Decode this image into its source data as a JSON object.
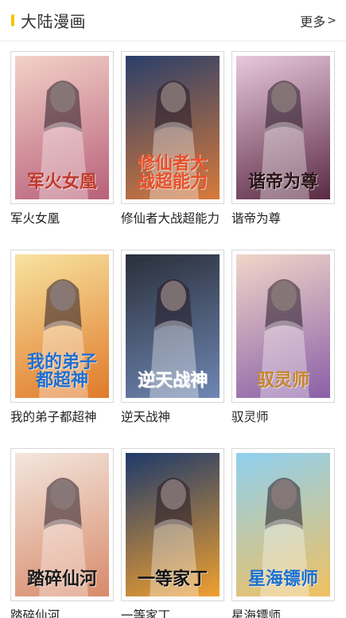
{
  "header": {
    "title": "大陆漫画",
    "more_label": "更多",
    "more_arrow": ">",
    "accent_color": "#f5c500"
  },
  "comics": [
    {
      "title": "军火女凰",
      "cover_text": "军火女凰",
      "colors": [
        "#f3d2c8",
        "#b8607a"
      ],
      "text_color": "#c0392b"
    },
    {
      "title": "修仙者大战超能力",
      "cover_text": "修仙者大战超能力",
      "colors": [
        "#2a3f6a",
        "#d87a3a"
      ],
      "text_color": "#e8502a"
    },
    {
      "title": "谐帝为尊",
      "cover_text": "谐帝为尊",
      "colors": [
        "#e8c8dc",
        "#5a2a44"
      ],
      "text_color": "#2a1418"
    },
    {
      "title": "我的弟子都超神",
      "cover_text": "我的弟子都超神",
      "colors": [
        "#f7e3a0",
        "#e07a2a"
      ],
      "text_color": "#1f6fd0"
    },
    {
      "title": "逆天战神",
      "cover_text": "逆天战神",
      "colors": [
        "#2a2f3a",
        "#6f87b4"
      ],
      "text_color": "#ffffff"
    },
    {
      "title": "驭灵师",
      "cover_text": "驭灵师",
      "colors": [
        "#f0d6c8",
        "#8a5fa8"
      ],
      "text_color": "#c7862a"
    },
    {
      "title": "踏碎仙河",
      "cover_text": "踏碎仙河",
      "colors": [
        "#f3e6de",
        "#d88a6a"
      ],
      "text_color": "#1a1a1a"
    },
    {
      "title": "一等家丁",
      "cover_text": "一等家丁",
      "colors": [
        "#1e3a6a",
        "#f0a030"
      ],
      "text_color": "#111111"
    },
    {
      "title": "星海镖师",
      "cover_text": "星海镖师",
      "colors": [
        "#8fd0f0",
        "#f0c060"
      ],
      "text_color": "#1a6fd0"
    }
  ]
}
